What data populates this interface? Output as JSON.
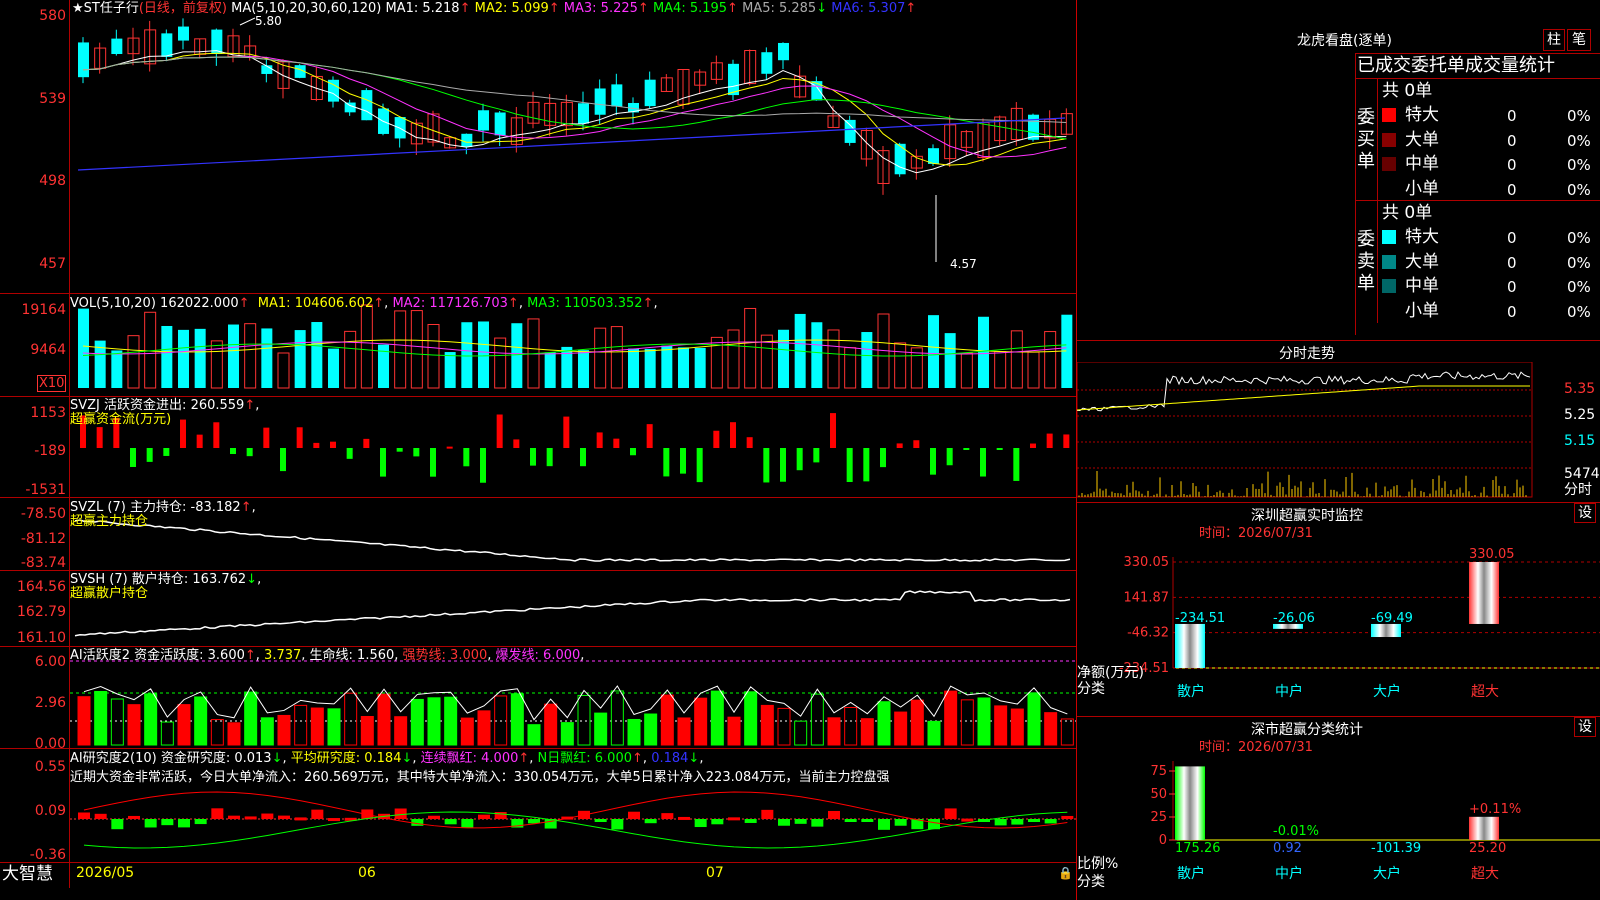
{
  "chart": {
    "header": {
      "name": "★ST任子行",
      "mode": "(日线，前复权)",
      "ma_label": "MA(5,10,20,30,60,120)",
      "ma": [
        {
          "label": "MA1:",
          "value": "5.218",
          "arrow": "↑",
          "color": "#ffffff"
        },
        {
          "label": "MA2:",
          "value": "5.099",
          "arrow": "↑",
          "color": "#ffff00"
        },
        {
          "label": "MA3:",
          "value": "5.225",
          "arrow": "↑",
          "color": "#ff33ff"
        },
        {
          "label": "MA4:",
          "value": "5.195",
          "arrow": "↑",
          "color": "#00ff00"
        },
        {
          "label": "MA5:",
          "value": "5.285",
          "arrow": "↓",
          "color": "#aaaaaa"
        },
        {
          "label": "MA6:",
          "value": "5.307",
          "arrow": "↑",
          "color": "#3333ff"
        }
      ]
    },
    "price_axis": [
      "580",
      "539",
      "498",
      "457"
    ],
    "price_high_label": "5.80",
    "price_low_label": "4.57",
    "vol": {
      "label": "VOL(5,10,20)",
      "value": "162022.000",
      "ma": [
        {
          "label": "MA1:",
          "value": "104606.602",
          "arrow": "↑",
          "color": "#ffff00"
        },
        {
          "label": "MA2:",
          "value": "117126.703",
          "arrow": "↑",
          "color": "#ff33ff"
        },
        {
          "label": "MA3:",
          "value": "110503.352",
          "arrow": "↑",
          "color": "#00ff00"
        }
      ],
      "axis": [
        "19164",
        "9464"
      ],
      "unit": "X10"
    },
    "svzj": {
      "label": "SVZJ",
      "name": "活跃资金进出:",
      "value": "260.559",
      "arrow": "↑",
      "sub": "超赢资金流(万元)",
      "axis": [
        "1153",
        "-189",
        "-1531"
      ]
    },
    "svzl": {
      "label": "SVZL (7)",
      "name": "主力持仓:",
      "value": "-83.182",
      "arrow": "↑",
      "sub": "超赢主力持仓",
      "axis": [
        "-78.50",
        "-81.12",
        "-83.74"
      ]
    },
    "svsh": {
      "label": "SVSH (7)",
      "name": "散户持仓:",
      "value": "163.762",
      "arrow": "↓",
      "sub": "超赢散户持仓",
      "axis": [
        "164.56",
        "162.79",
        "161.10"
      ]
    },
    "ai_active": {
      "label": "AI活跃度2",
      "items": [
        {
          "text": "资金活跃度: 3.600",
          "arrow": "↑",
          "color": "#ffffff"
        },
        {
          "text": "3.737",
          "arrow": "",
          "color": "#ffff00"
        },
        {
          "text": "生命线: 1.560",
          "arrow": "",
          "color": "#ffffff"
        },
        {
          "text": "强势线: 3.000",
          "arrow": "",
          "color": "#ff3333"
        },
        {
          "text": "爆发线: 6.000",
          "arrow": "",
          "color": "#ff33ff"
        }
      ],
      "axis": [
        "6.00",
        "2.96",
        "0.00"
      ]
    },
    "ai_research": {
      "label": "AI研究度2(10)",
      "items": [
        {
          "text": "资金研究度: 0.013",
          "arrow": "↓",
          "color": "#ffffff"
        },
        {
          "text": "平均研究度: 0.184",
          "arrow": "↓",
          "color": "#ffff00"
        },
        {
          "text": "连续飘红: 4.000",
          "arrow": "↑",
          "color": "#ff33ff"
        },
        {
          "text": "N日飘红: 6.000",
          "arrow": "↑",
          "color": "#00ff00"
        },
        {
          "text": "0.184",
          "arrow": "↓",
          "color": "#3333ff"
        }
      ],
      "comment": "近期大资金非常活跃，今日大单净流入：260.569万元，其中特大单净流入：330.054万元，大单5日累计净入223.084万元，当前主力控盘强",
      "axis": [
        "0.55",
        "0.09",
        "-0.36"
      ]
    },
    "date_labels": [
      "2026/05",
      "06",
      "07"
    ],
    "brand": "大智慧"
  },
  "right": {
    "lhb": {
      "title": "龙虎看盘(逐单)",
      "btn_bar": "柱",
      "btn_pen": "笔",
      "tabs": [
        "已成交",
        "委托单",
        "成交量统计"
      ],
      "buy": {
        "side_label": "委买单",
        "total": "共 0单",
        "rows": [
          {
            "name": "特大",
            "count": "0",
            "pct": "0%",
            "color": "#ff0000"
          },
          {
            "name": "大单",
            "count": "0",
            "pct": "0%",
            "color": "#880000"
          },
          {
            "name": "中单",
            "count": "0",
            "pct": "0%",
            "color": "#660000"
          },
          {
            "name": "小单",
            "count": "0",
            "pct": "0%",
            "color": ""
          }
        ]
      },
      "sell": {
        "side_label": "委卖单",
        "total": "共 0单",
        "rows": [
          {
            "name": "特大",
            "count": "0",
            "pct": "0%",
            "color": "#00ffff"
          },
          {
            "name": "大单",
            "count": "0",
            "pct": "0%",
            "color": "#008888"
          },
          {
            "name": "中单",
            "count": "0",
            "pct": "0%",
            "color": "#006666"
          },
          {
            "name": "小单",
            "count": "0",
            "pct": "0%",
            "color": ""
          }
        ]
      }
    },
    "intraday": {
      "title": "分时走势",
      "axis": [
        "5.35",
        "5.25",
        "5.15"
      ],
      "vol_label": "5474",
      "vol_unit": "分时"
    },
    "sz_monitor": {
      "title": "深圳超赢实时监控",
      "btn": "设",
      "time_label": "时间：2026/07/31",
      "axis": [
        "330.05",
        "141.87",
        "-46.32",
        "-234.51"
      ],
      "y_title": "净额(万元)",
      "x_title": "分类",
      "bars": [
        {
          "name": "散户",
          "value": -234.51,
          "label": "-234.51"
        },
        {
          "name": "中户",
          "value": -26.06,
          "label": "-26.06"
        },
        {
          "name": "大户",
          "value": -69.49,
          "label": "-69.49"
        },
        {
          "name": "超大",
          "value": 330.05,
          "label": "330.05"
        }
      ]
    },
    "sz_class": {
      "title": "深市超赢分类统计",
      "btn": "设",
      "time_label": "时间：2026/07/31",
      "axis": [
        "75",
        "50",
        "25",
        "0"
      ],
      "y_title": "比例%",
      "x_title": "分类",
      "bars": [
        {
          "name": "散户",
          "value": 175.26,
          "label": "175.26",
          "top_label": ""
        },
        {
          "name": "中户",
          "value": 0.92,
          "label": "0.92",
          "top_label": "-0.01%"
        },
        {
          "name": "大户",
          "value": -101.39,
          "label": "-101.39",
          "top_label": ""
        },
        {
          "name": "超大",
          "value": 25.2,
          "label": "25.20",
          "top_label": "+0.11%"
        }
      ]
    }
  }
}
